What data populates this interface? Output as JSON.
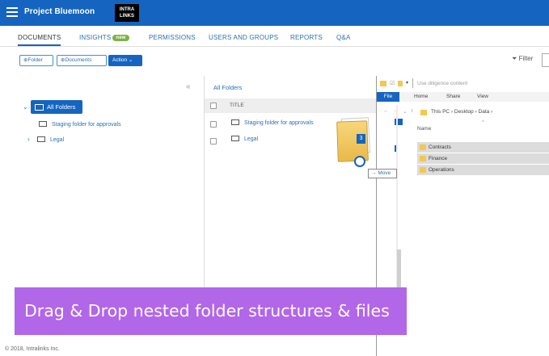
{
  "header": {
    "project_title": "Project Bluemoon",
    "logo_text": "INTRA LINKS"
  },
  "tabs": [
    {
      "label": "DOCUMENTS"
    },
    {
      "label": "INSIGHTS",
      "badge": "new"
    },
    {
      "label": "PERMISSIONS"
    },
    {
      "label": "USERS AND GROUPS"
    },
    {
      "label": "REPORTS"
    },
    {
      "label": "Q&A"
    }
  ],
  "toolbar": {
    "folder": "Folder",
    "documents": "Documents",
    "action": "Action",
    "filter": "Filter"
  },
  "tree": {
    "all_folders": "All Folders",
    "items": [
      "Staging folder for approvals",
      "Legal"
    ]
  },
  "list": {
    "breadcrumb": "All Folders",
    "title_header": "TITLE",
    "rows": [
      "Staging folder for approvals",
      "Legal"
    ]
  },
  "drag": {
    "count": "3",
    "tooltip": "Move"
  },
  "explorer": {
    "title": "Use diligence content",
    "ribbon_tabs": [
      "File",
      "Home",
      "Share",
      "View"
    ],
    "address": "This PC  ›  Desktop  ›  Data  ›",
    "column": "Name",
    "folders": [
      "Contracts",
      "Finance",
      "Operations"
    ]
  },
  "caption": "Drag & Drop nested folder structures & files",
  "footer": "© 2018, Intralinks Inc.",
  "colors": {
    "brand": "#1565c0",
    "caption_bg": "#b266e8",
    "badge": "#7cb342"
  }
}
